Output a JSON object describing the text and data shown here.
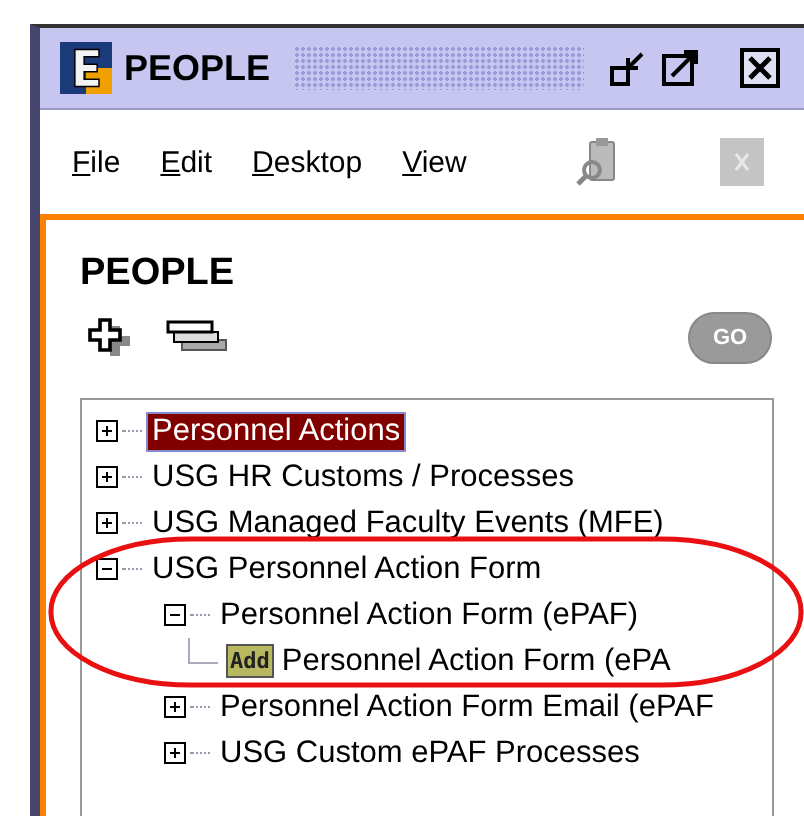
{
  "window": {
    "title": "PEOPLE"
  },
  "menu": [
    {
      "label": "File"
    },
    {
      "label": "Edit"
    },
    {
      "label": "Desktop"
    },
    {
      "label": "View"
    }
  ],
  "panel": {
    "heading": "PEOPLE",
    "go_button": {
      "label": "GO",
      "disabled": true
    }
  },
  "tree": [
    {
      "label": "Personnel Actions",
      "selected": true,
      "expanded": false
    },
    {
      "label": "USG HR Customs / Processes",
      "selected": false,
      "expanded": false
    },
    {
      "label": "USG Managed Faculty Events (MFE)",
      "selected": false,
      "expanded": false
    },
    {
      "label": "USG Personnel Action Form",
      "selected": false,
      "expanded": true,
      "children": [
        {
          "label": "Personnel Action Form (ePAF)",
          "selected": false,
          "expanded": true,
          "children": [
            {
              "label": "Personnel Action Form (ePA",
              "selected": false,
              "kind": "badge",
              "badge": "Add"
            }
          ]
        },
        {
          "label": "Personnel Action Form Email (ePAF",
          "selected": false,
          "expanded": false
        },
        {
          "label": "USG Custom ePAF Processes",
          "selected": false,
          "expanded": false
        }
      ]
    }
  ]
}
